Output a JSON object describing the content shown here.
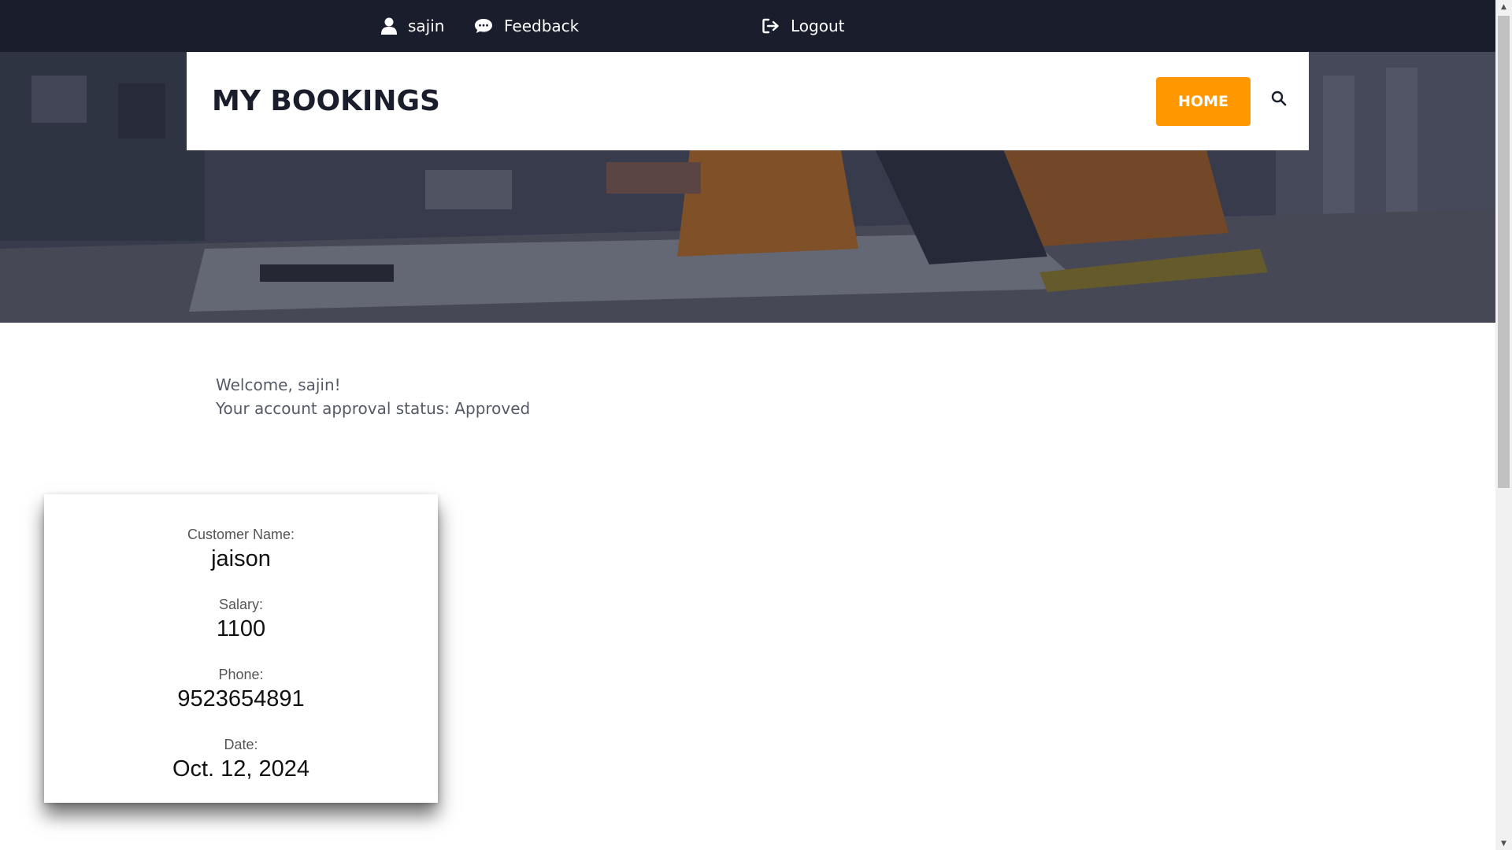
{
  "topbar": {
    "user_name": "sajin",
    "feedback_label": "Feedback",
    "logout_label": "Logout"
  },
  "header": {
    "page_title": "MY BOOKINGS",
    "home_label": "HOME"
  },
  "welcome": {
    "greeting": "Welcome, sajin!",
    "status": "Your account approval status: Approved"
  },
  "booking": {
    "customer_name_label": "Customer Name:",
    "customer_name": "jaison",
    "salary_label": "Salary:",
    "salary": "1100",
    "phone_label": "Phone:",
    "phone": "9523654891",
    "date_label": "Date:",
    "date": "Oct. 12, 2024"
  },
  "icons": {
    "user": "user-icon",
    "feedback": "chat-bubble-icon",
    "logout": "logout-icon",
    "search": "search-icon"
  },
  "colors": {
    "topbar_bg": "#1a1d2b",
    "accent": "#ff9800",
    "title": "#1a1d2b"
  }
}
